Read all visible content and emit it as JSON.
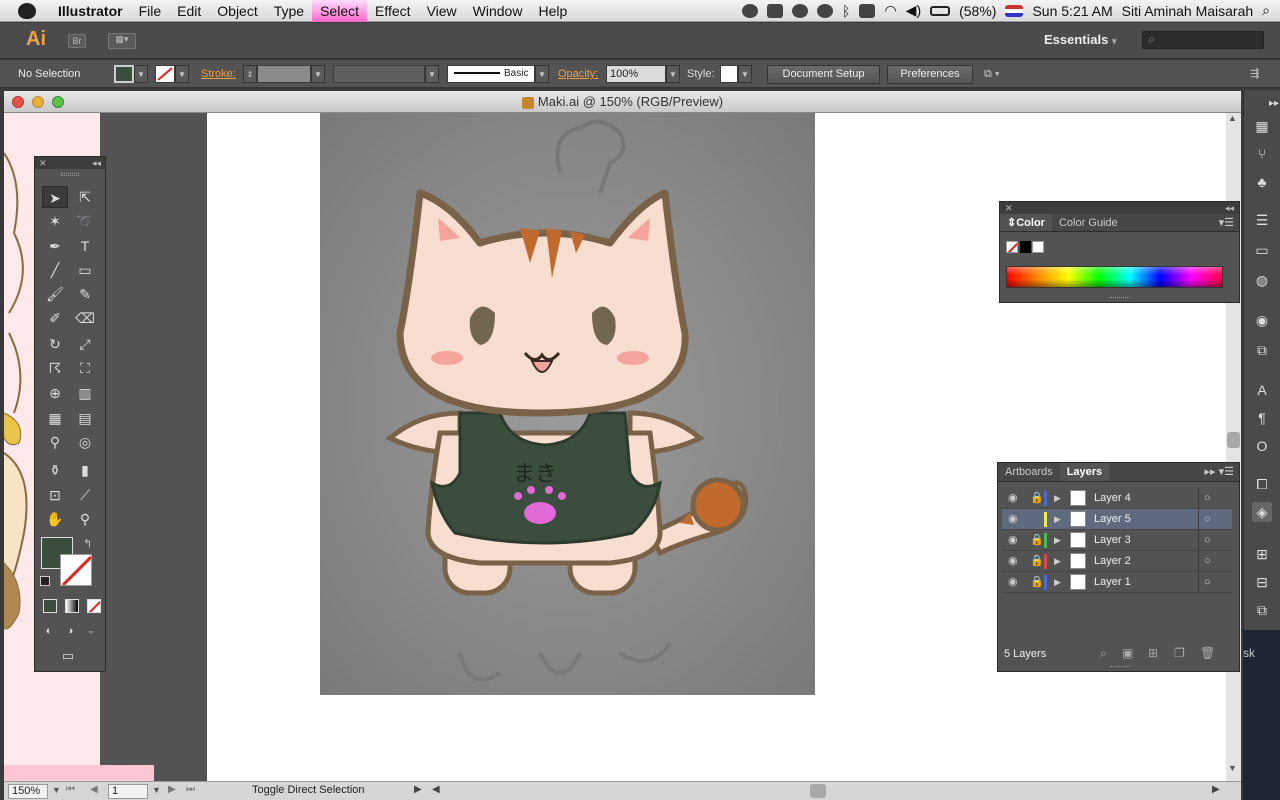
{
  "menubar": {
    "app_name": "Illustrator",
    "menus": [
      "File",
      "Edit",
      "Object",
      "Type",
      "Select",
      "Effect",
      "View",
      "Window",
      "Help"
    ],
    "battery": "(58%)",
    "clock": "Sun 5:21 AM",
    "user": "Siti Aminah Maisarah"
  },
  "appbar": {
    "logo": "Ai",
    "bridge_label": "Br",
    "workspace": "Essentials",
    "workspace_arrow": "▾",
    "search_placeholder": ""
  },
  "control_bar": {
    "selection_status": "No Selection",
    "stroke_label": "Stroke:",
    "brush_label": "Basic",
    "opacity_label": "Opacity:",
    "opacity_value": "100%",
    "style_label": "Style:",
    "document_setup": "Document Setup",
    "preferences": "Preferences",
    "fill_color": "#3b4d3c"
  },
  "document": {
    "title": "Maki.ai @ 150% (RGB/Preview)",
    "zoom": "150%",
    "artboard_number": "1",
    "status_text": "Toggle Direct Selection"
  },
  "artwork": {
    "apron_text": "まき"
  },
  "tools_panel": {
    "fill_color": "#3b4d3c"
  },
  "color_panel": {
    "tabs": [
      "Color",
      "Color Guide"
    ]
  },
  "layers_panel": {
    "tabs": [
      "Artboards",
      "Layers"
    ],
    "layers": [
      {
        "name": "Layer 4",
        "color": "#4d6bd6",
        "locked": true,
        "selected": false
      },
      {
        "name": "Layer 5",
        "color": "#f2e64a",
        "locked": false,
        "selected": true
      },
      {
        "name": "Layer 3",
        "color": "#3cc24a",
        "locked": true,
        "selected": false
      },
      {
        "name": "Layer 2",
        "color": "#e04848",
        "locked": true,
        "selected": false
      },
      {
        "name": "Layer 1",
        "color": "#4d6bd6",
        "locked": true,
        "selected": false
      }
    ],
    "count_label": "5 Layers"
  },
  "background_fragments": {
    "right_edge_text": "sk"
  }
}
